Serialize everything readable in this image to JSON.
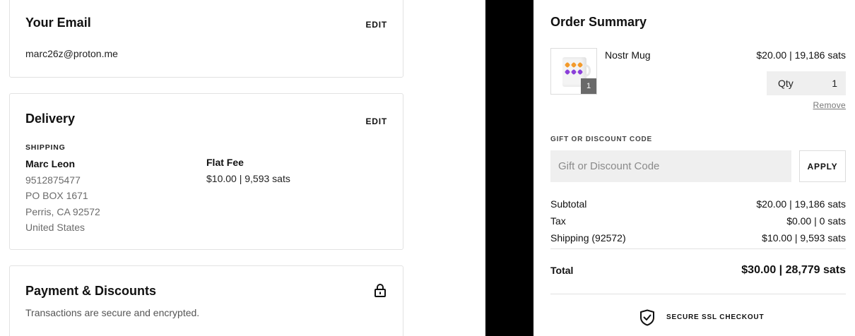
{
  "email_section": {
    "title": "Your Email",
    "edit_label": "EDIT",
    "email": "marc26z@proton.me"
  },
  "delivery_section": {
    "title": "Delivery",
    "edit_label": "EDIT",
    "shipping_label": "SHIPPING",
    "name": "Marc Leon",
    "phone": "9512875477",
    "address_line1": "PO BOX 1671",
    "city_line": "Perris, CA 92572",
    "country": "United States",
    "fee_name": "Flat Fee",
    "fee_price": "$10.00 | 9,593 sats"
  },
  "payment_section": {
    "title": "Payment & Discounts",
    "subtitle": "Transactions are secure and encrypted.",
    "icon": "lock-icon"
  },
  "order_summary": {
    "title": "Order Summary",
    "item": {
      "name": "Nostr Mug",
      "price": "$20.00 | 19,186 sats",
      "badge_qty": "1",
      "qty_label": "Qty",
      "qty_value": "1",
      "remove_label": "Remove"
    },
    "gift": {
      "label": "GIFT OR DISCOUNT CODE",
      "placeholder": "Gift or Discount Code",
      "apply_label": "APPLY"
    },
    "subtotal": {
      "label": "Subtotal",
      "value": "$20.00 | 19,186 sats"
    },
    "tax": {
      "label": "Tax",
      "value": "$0.00 | 0 sats"
    },
    "shipping": {
      "label": "Shipping (92572)",
      "value": "$10.00 | 9,593 sats"
    },
    "total": {
      "label": "Total",
      "value": "$30.00 | 28,779 sats"
    },
    "ssl_label": "SECURE SSL CHECKOUT",
    "ssl_icon": "shield-check-icon"
  }
}
